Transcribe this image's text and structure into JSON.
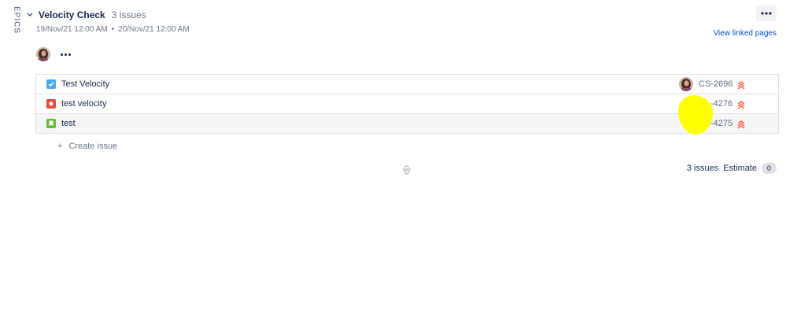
{
  "rail": {
    "label": "EPICS"
  },
  "sprint": {
    "name": "Velocity Check",
    "issue_count": "3 issues",
    "start": "19/Nov/21 12:00 AM",
    "separator": "•",
    "end": "20/Nov/21 12:00 AM"
  },
  "actions": {
    "linked_pages": "View linked pages"
  },
  "issues": [
    {
      "summary": "Test Velocity",
      "key": "CS-2696",
      "type": "task",
      "type_color": "#4bade8"
    },
    {
      "summary": "test velocity",
      "key": "-4276",
      "type": "bug",
      "type_color": "#e5493a"
    },
    {
      "summary": "test",
      "key": "-4275",
      "type": "story",
      "type_color": "#63ba3c"
    }
  ],
  "create": {
    "plus": "+",
    "label": "Create issue"
  },
  "footer": {
    "count": "3 issues",
    "estimate_label": "Estimate",
    "estimate_value": "0"
  },
  "colors": {
    "priority": "#ff5630",
    "link": "#0052cc",
    "redaction": "#ffff00"
  }
}
